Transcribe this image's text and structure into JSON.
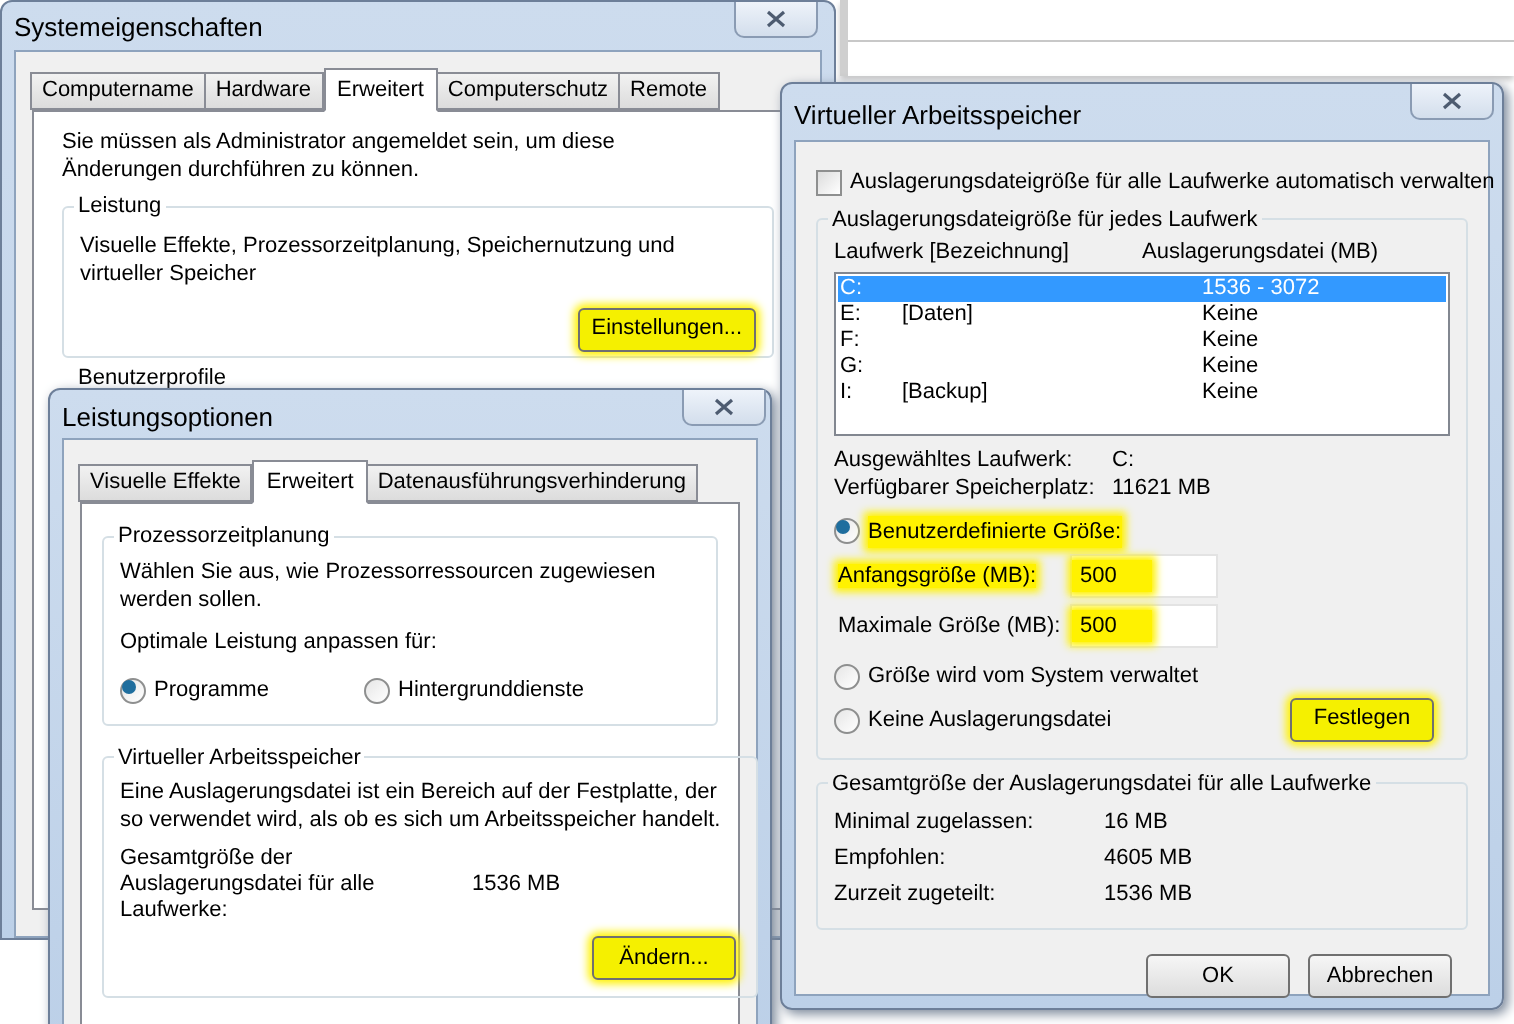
{
  "system_properties": {
    "title": "Systemeigenschaften",
    "tabs": [
      {
        "label": "Computername",
        "selected": false
      },
      {
        "label": "Hardware",
        "selected": false
      },
      {
        "label": "Erweitert",
        "selected": true
      },
      {
        "label": "Computerschutz",
        "selected": false
      },
      {
        "label": "Remote",
        "selected": false
      }
    ],
    "notice": "Sie müssen als Administrator angemeldet sein, um diese Änderungen durchführen zu können.",
    "performance_group": {
      "title": "Leistung",
      "text": "Visuelle Effekte, Prozessorzeitplanung, Speichernutzung und virtueller Speicher",
      "button": {
        "label": "Einstellungen...",
        "highlighted": true
      }
    },
    "next_group_title": "Benutzerprofile"
  },
  "performance_options": {
    "title": "Leistungsoptionen",
    "tabs": [
      {
        "label": "Visuelle Effekte",
        "selected": false
      },
      {
        "label": "Erweitert",
        "selected": true
      },
      {
        "label": "Datenausführungsverhinderung",
        "selected": false
      }
    ],
    "scheduling_group": {
      "title": "Prozessorzeitplanung",
      "text": "Wählen Sie aus, wie Prozessorressourcen zugewiesen werden sollen.",
      "prompt": "Optimale Leistung anpassen für:",
      "options": [
        {
          "label": "Programme",
          "selected": true
        },
        {
          "label": "Hintergrunddienste",
          "selected": false
        }
      ]
    },
    "memory_group": {
      "title": "Virtueller Arbeitsspeicher",
      "text": "Eine Auslagerungsdatei ist ein Bereich auf der Festplatte, der so verwendet wird, als ob es sich um Arbeitsspeicher handelt.",
      "total_label": "Gesamtgröße der Auslagerungsdatei für alle Laufwerke:",
      "total_value": "1536 MB",
      "button": {
        "label": "Ändern...",
        "highlighted": true
      }
    }
  },
  "virtual_memory": {
    "title": "Virtueller Arbeitsspeicher",
    "auto_manage": {
      "label": "Auslagerungsdateigröße für alle Laufwerke automatisch verwalten",
      "checked": false
    },
    "drives_group": {
      "title": "Auslagerungsdateigröße für jedes Laufwerk",
      "columns": [
        "Laufwerk [Bezeichnung]",
        "Auslagerungsdatei (MB)"
      ],
      "drives": [
        {
          "drive": "C:",
          "size": "1536 - 3072",
          "selected": true
        },
        {
          "drive": "E:",
          "label": "[Daten]",
          "size": "Keine",
          "selected": false
        },
        {
          "drive": "F:",
          "size": "Keine",
          "selected": false
        },
        {
          "drive": "G:",
          "size": "Keine",
          "selected": false
        },
        {
          "drive": "I:",
          "label": "[Backup]",
          "size": "Keine",
          "selected": false
        }
      ],
      "info": [
        {
          "label": "Ausgewähltes Laufwerk:",
          "value": "C:"
        },
        {
          "label": "Verfügbarer Speicherplatz:",
          "value": "11621 MB"
        }
      ],
      "size_options": [
        {
          "label": "Benutzerdefinierte Größe:",
          "selected": true,
          "highlighted": true
        },
        {
          "label": "Größe wird vom System verwaltet",
          "selected": false,
          "highlighted": false
        },
        {
          "label": "Keine Auslagerungsdatei",
          "selected": false,
          "highlighted": false
        }
      ],
      "size_fields": [
        {
          "label": "Anfangsgröße (MB):",
          "value": "500",
          "label_highlighted": true,
          "value_highlighted": true
        },
        {
          "label": "Maximale Größe (MB):",
          "value": "500",
          "label_highlighted": false,
          "value_highlighted": true
        }
      ],
      "set_button": {
        "label": "Festlegen",
        "highlighted": true
      }
    },
    "totals_group": {
      "title": "Gesamtgröße der Auslagerungsdatei für alle Laufwerke",
      "rows": [
        {
          "label": "Minimal zugelassen:",
          "value": "16 MB"
        },
        {
          "label": "Empfohlen:",
          "value": "4605 MB"
        },
        {
          "label": "Zurzeit zugeteilt:",
          "value": "1536 MB"
        }
      ]
    },
    "buttons": [
      {
        "label": "OK"
      },
      {
        "label": "Abbrechen"
      }
    ]
  }
}
